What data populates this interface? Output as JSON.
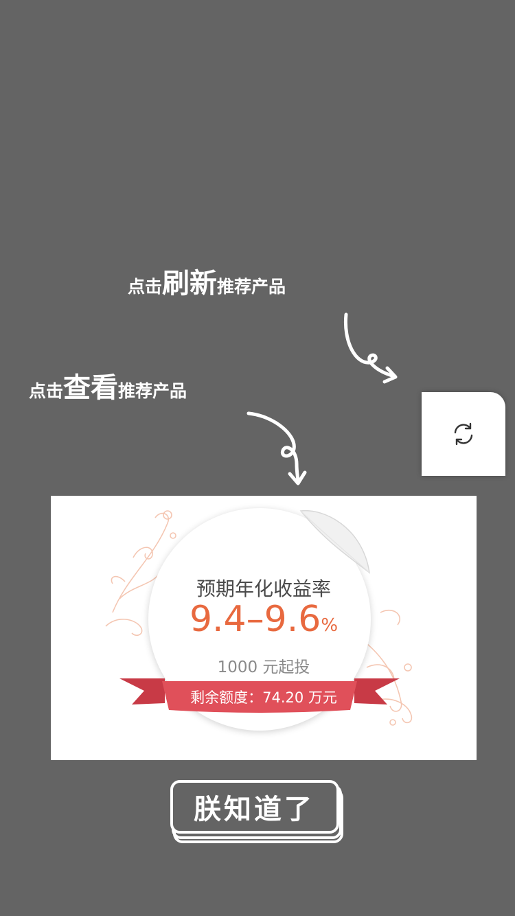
{
  "hints": {
    "refresh": {
      "prefix": "点击",
      "emphasis": "刷新",
      "suffix": "推荐产品"
    },
    "view": {
      "prefix": "点击",
      "emphasis": "查看",
      "suffix": "推荐产品"
    }
  },
  "refresh_button": {
    "icon": "refresh-icon"
  },
  "product": {
    "rate_label": "预期年化收益率",
    "rate_value": "9.4–9.6",
    "rate_unit": "%",
    "min_invest": "1000 元起投",
    "remaining": "剩余额度：74.20 万元"
  },
  "confirm_button": {
    "label": "朕知道了"
  },
  "colors": {
    "overlay": "#646464",
    "rate": "#e8693f",
    "ribbon": "#e0505a",
    "ornament": "#f2b9a0"
  }
}
